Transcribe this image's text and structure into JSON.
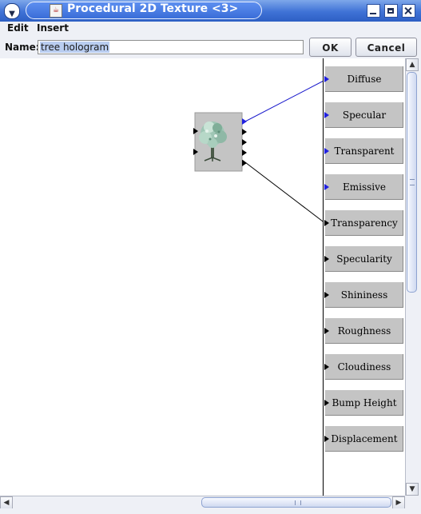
{
  "window": {
    "title": "Procedural 2D Texture <3>",
    "menu_glyph": "▼",
    "app_icon": "java-cup-icon"
  },
  "menu": {
    "items": [
      {
        "label": "Edit"
      },
      {
        "label": "Insert"
      }
    ]
  },
  "namebar": {
    "label": "Name:",
    "value": "tree hologram",
    "ok_label": "OK",
    "cancel_label": "Cancel"
  },
  "module": {
    "icon": "tree-image-icon",
    "input_ports": 2,
    "output_ports": 5
  },
  "output_panel": {
    "ports": [
      {
        "label": "Diffuse",
        "type": "color"
      },
      {
        "label": "Specular",
        "type": "color"
      },
      {
        "label": "Transparent",
        "type": "color"
      },
      {
        "label": "Emissive",
        "type": "color"
      },
      {
        "label": "Transparency",
        "type": "number"
      },
      {
        "label": "Specularity",
        "type": "number"
      },
      {
        "label": "Shininess",
        "type": "number"
      },
      {
        "label": "Roughness",
        "type": "number"
      },
      {
        "label": "Cloudiness",
        "type": "number"
      },
      {
        "label": "Bump Height",
        "type": "number"
      },
      {
        "label": "Displacement",
        "type": "number"
      }
    ]
  },
  "connections": [
    {
      "from_output": 1,
      "to": "Diffuse",
      "color": "#1a1acc"
    },
    {
      "from_output": 5,
      "to": "Transparency",
      "color": "#000000"
    }
  ],
  "colors": {
    "title_bar": "#3f72d6",
    "color_port": "#2020e0",
    "number_port": "#000000",
    "port_background": "#c4c4c4"
  }
}
